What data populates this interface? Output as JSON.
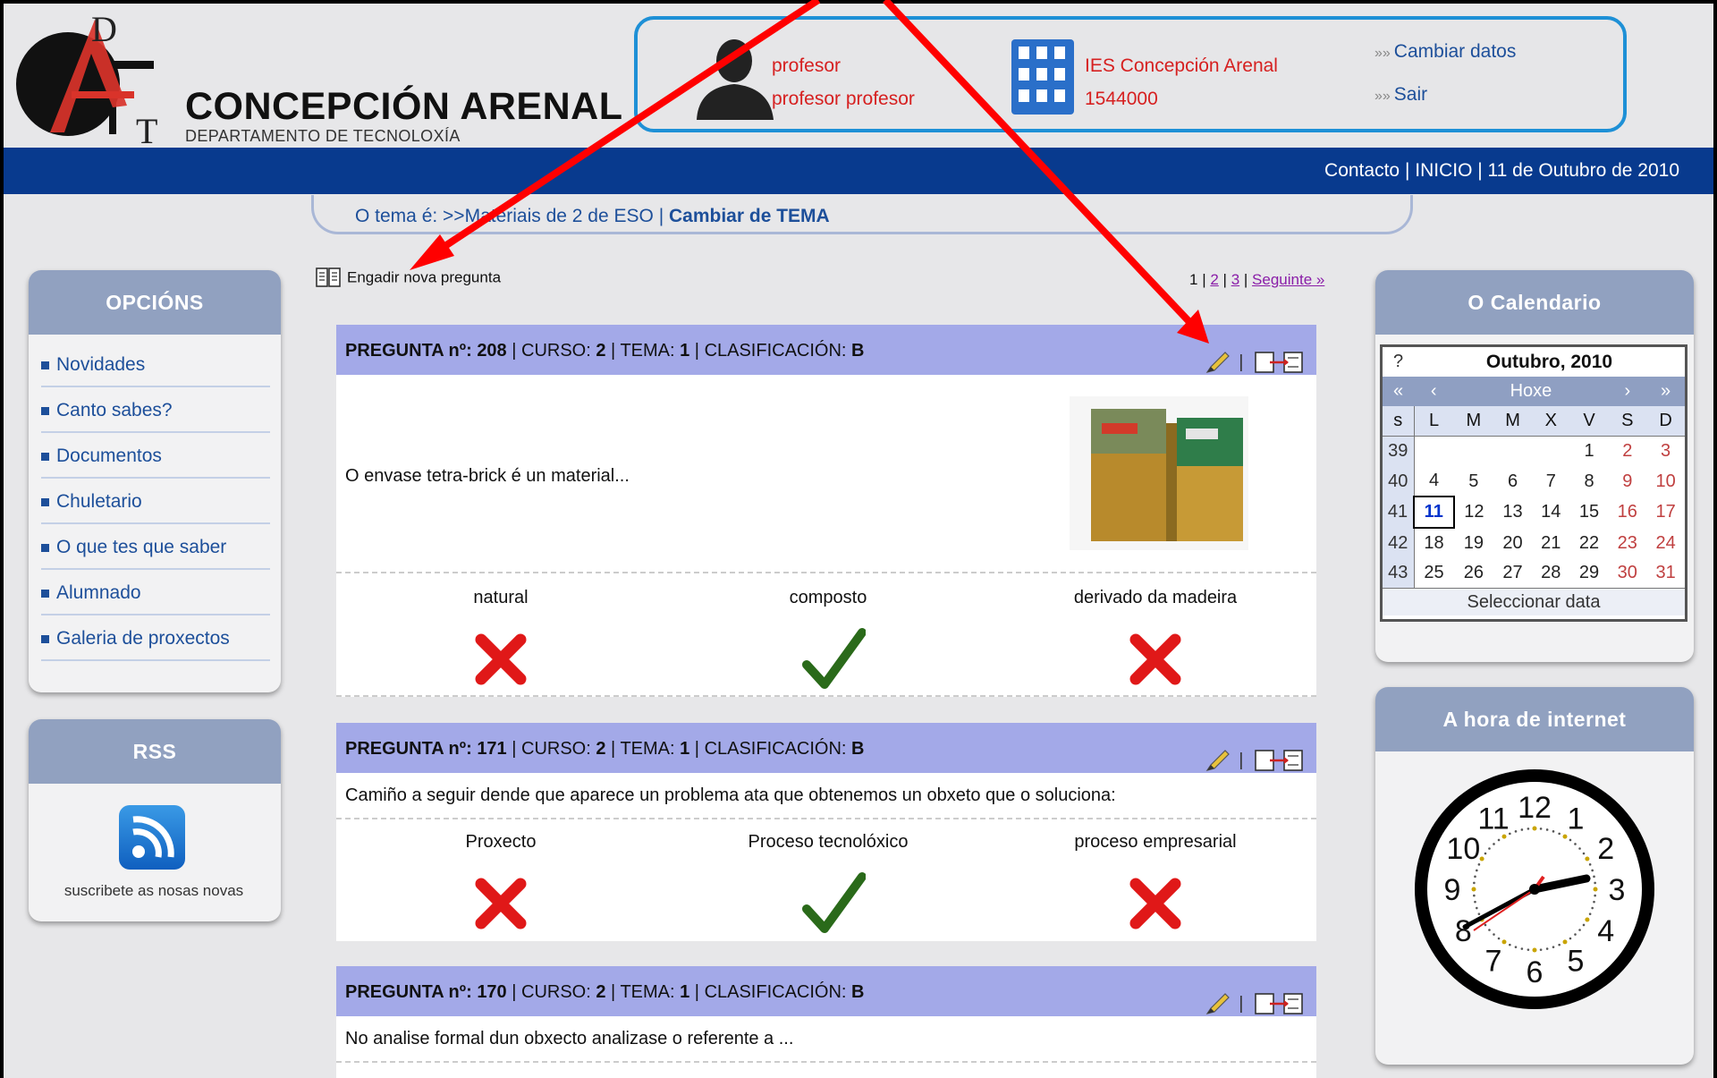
{
  "header": {
    "logo_letters": "DAT",
    "brand_name": "CONCEPCIÓN  ARENAL",
    "brand_sub": "DEPARTAMENTO DE TECNOLOXÍA"
  },
  "user": {
    "role": "profesor",
    "name": "profesor profesor",
    "school": "IES Concepción Arenal",
    "school_code": "1544000",
    "change_data": "Cambiar datos",
    "logout": "Sair"
  },
  "topbar": {
    "contact": "Contacto",
    "home": "INICIO",
    "date": "11 de Outubro de 2010"
  },
  "topic": {
    "prefix": "O tema é: >>",
    "name": "Materiais de 2 de ESO",
    "change": "Cambiar de TEMA"
  },
  "left_menu": {
    "title": "OPCIÓNS",
    "items": [
      "Novidades",
      "Canto sabes?",
      "Documentos",
      "Chuletario",
      "O que tes que saber",
      "Alumnado",
      "Galeria de proxectos"
    ]
  },
  "rss": {
    "title": "RSS",
    "text": "suscribete as nosas novas"
  },
  "main": {
    "add_question": "Engadir nova pregunta",
    "pages": [
      "1",
      "2",
      "3"
    ],
    "next": "Seguinte »",
    "questions": [
      {
        "label": "PREGUNTA nº:",
        "num": "208",
        "course_label": "CURSO:",
        "course": "2",
        "topic_label": "TEMA:",
        "topic": "1",
        "class_label": "CLASIFICACIÓN:",
        "class": "B",
        "text": "O envase tetra-brick é un material...",
        "answers": [
          {
            "text": "natural",
            "correct": false
          },
          {
            "text": "composto",
            "correct": true
          },
          {
            "text": "derivado da madeira",
            "correct": false
          }
        ]
      },
      {
        "label": "PREGUNTA nº:",
        "num": "171",
        "course_label": "CURSO:",
        "course": "2",
        "topic_label": "TEMA:",
        "topic": "1",
        "class_label": "CLASIFICACIÓN:",
        "class": "B",
        "text": "Camiño a seguir dende que aparece un problema ata que obtenemos un obxeto que o soluciona:",
        "answers": [
          {
            "text": "Proxecto",
            "correct": false
          },
          {
            "text": "Proceso tecnolóxico",
            "correct": true
          },
          {
            "text": "proceso empresarial",
            "correct": false
          }
        ]
      },
      {
        "label": "PREGUNTA nº:",
        "num": "170",
        "course_label": "CURSO:",
        "course": "2",
        "topic_label": "TEMA:",
        "topic": "1",
        "class_label": "CLASIFICACIÓN:",
        "class": "B",
        "text": "No analise formal dun obxecto analizase o referente a ..."
      }
    ]
  },
  "calendar": {
    "panel_title": "O Calendario",
    "help": "?",
    "month": "Outubro, 2010",
    "nav": [
      "«",
      "‹",
      "Hoxe",
      "›",
      "»"
    ],
    "week_header": "s",
    "days": [
      "L",
      "M",
      "M",
      "X",
      "V",
      "S",
      "D"
    ],
    "weeks": [
      {
        "n": "39",
        "d": [
          "",
          "",
          "",
          "",
          "1",
          "2",
          "3"
        ]
      },
      {
        "n": "40",
        "d": [
          "4",
          "5",
          "6",
          "7",
          "8",
          "9",
          "10"
        ]
      },
      {
        "n": "41",
        "d": [
          "11",
          "12",
          "13",
          "14",
          "15",
          "16",
          "17"
        ]
      },
      {
        "n": "42",
        "d": [
          "18",
          "19",
          "20",
          "21",
          "22",
          "23",
          "24"
        ]
      },
      {
        "n": "43",
        "d": [
          "25",
          "26",
          "27",
          "28",
          "29",
          "30",
          "31"
        ]
      }
    ],
    "today": "11",
    "footer": "Seleccionar data"
  },
  "clock_panel": {
    "title": "A hora de internet",
    "numbers": [
      "12",
      "1",
      "2",
      "3",
      "4",
      "5",
      "6",
      "7",
      "8",
      "9",
      "10",
      "11"
    ]
  },
  "colors": {
    "blue_bar": "#083a8e",
    "question_header": "#a3a9e8",
    "annotation_arrow": "#ff0000",
    "link": "#1d4f9a"
  }
}
